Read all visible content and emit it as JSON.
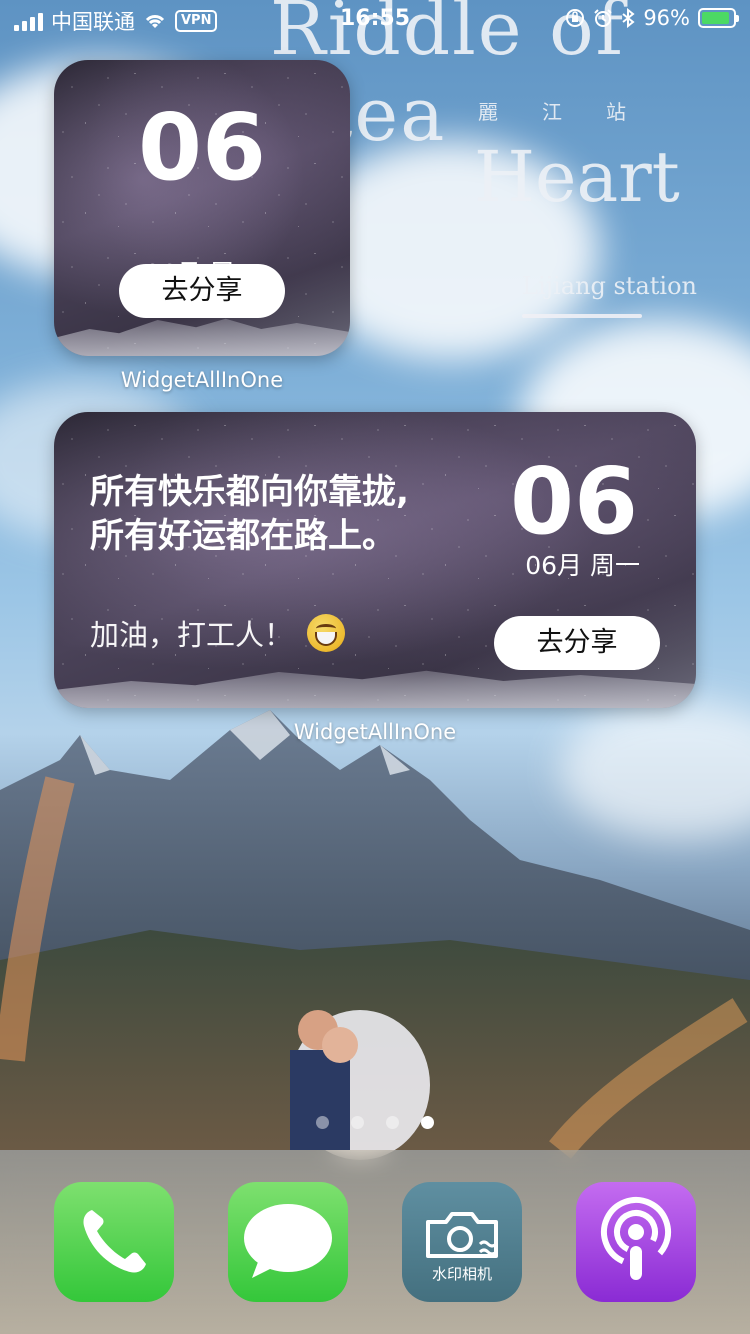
{
  "status_bar": {
    "carrier": "中国联通",
    "vpn": "VPN",
    "time": "16:55",
    "battery_percent": "96%",
    "icons": [
      "signal-icon",
      "wifi-icon",
      "vpn-badge",
      "orientation-lock-icon",
      "alarm-icon",
      "bluetooth-icon",
      "battery-icon"
    ]
  },
  "wallpaper": {
    "title_line1": "Riddle of Stea",
    "subtitle_cn": "麗　江　站",
    "title_line2": "Heart",
    "station": "Lijiang station"
  },
  "widget_small": {
    "day": "06",
    "date_line": "06月 周一",
    "share_label": "去分享",
    "app_label": "WidgetAllInOne"
  },
  "widget_medium": {
    "quote_line1": "所有快乐都向你靠拢,",
    "quote_line2": "所有好运都在路上。",
    "cheer": "加油，打工人！",
    "emoji": "grinning-face-emoji",
    "day": "06",
    "date_line": "06月 周一",
    "share_label": "去分享",
    "app_label": "WidgetAllInOne"
  },
  "page_dots": {
    "count": 4,
    "active_index": 3
  },
  "dock": {
    "apps": [
      {
        "name": "phone",
        "icon": "phone-icon",
        "label": ""
      },
      {
        "name": "messages",
        "icon": "message-bubble-icon",
        "label": ""
      },
      {
        "name": "watermark-camera",
        "icon": "camera-icon",
        "label": "水印相机"
      },
      {
        "name": "podcasts",
        "icon": "podcast-icon",
        "label": ""
      }
    ]
  },
  "colors": {
    "battery_green": "#4cd964",
    "dock_green": "#34c73a",
    "camera_teal": "#4f7d8d",
    "podcast_purple": "#9b3fe0"
  }
}
